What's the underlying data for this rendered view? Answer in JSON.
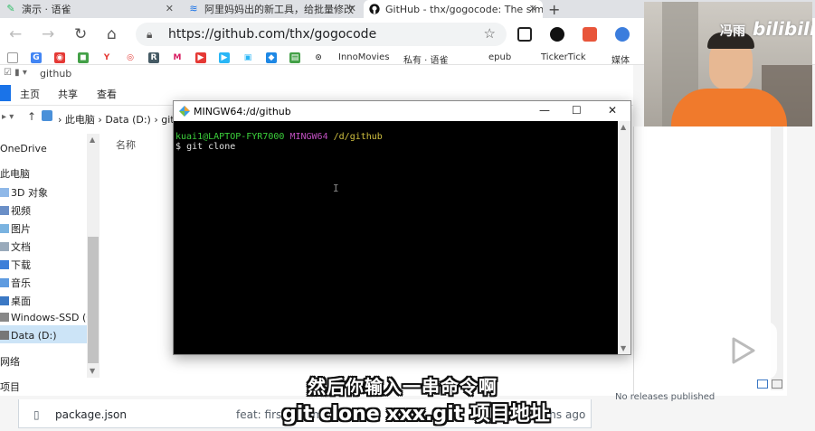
{
  "browser": {
    "tabs": [
      {
        "title": "演示 · 语雀",
        "active": false
      },
      {
        "title": "阿里妈妈出的新工具，给批量修改",
        "active": false
      },
      {
        "title": "GitHub - thx/gogocode: The sim",
        "active": true
      }
    ],
    "url": "https://github.com/thx/gogocode",
    "bookmarks": [
      "InnoMovies",
      "私有 · 语雀",
      "epub",
      "TickerTick",
      "媒体"
    ],
    "colors": {
      "accent": "#1a73e8"
    }
  },
  "explorer": {
    "title": "github",
    "ribbon": [
      "主页",
      "共享",
      "查看"
    ],
    "breadcrumb": [
      "此电脑",
      "Data (D:)",
      "git"
    ],
    "sidebar": [
      {
        "label": "OneDrive",
        "icon": "cloud-icon"
      },
      {
        "label": "此电脑",
        "icon": "computer-icon"
      },
      {
        "label": "3D 对象",
        "icon": "cube-icon"
      },
      {
        "label": "视频",
        "icon": "video-icon"
      },
      {
        "label": "图片",
        "icon": "image-icon"
      },
      {
        "label": "文档",
        "icon": "document-icon"
      },
      {
        "label": "下载",
        "icon": "download-icon"
      },
      {
        "label": "音乐",
        "icon": "music-icon"
      },
      {
        "label": "桌面",
        "icon": "desktop-icon"
      },
      {
        "label": "Windows-SSD (C:)",
        "icon": "drive-icon"
      },
      {
        "label": "Data (D:)",
        "icon": "drive-icon"
      },
      {
        "label": "网络",
        "icon": "network-icon"
      },
      {
        "label": "项目",
        "icon": "none"
      }
    ],
    "column_name": "名称"
  },
  "terminal": {
    "title": "MINGW64:/d/github",
    "prompt_user": "kuai1@LAPTOP-FYR7000",
    "prompt_env": "MINGW64",
    "prompt_path": "/d/github",
    "command_prefix": "$",
    "command": "git clone"
  },
  "github": {
    "file_name": "package.json",
    "commit_message": "feat: first comm",
    "age": "nths ago",
    "no_releases": "No releases published"
  },
  "overlay": {
    "streamer_name": "冯雨",
    "logo_text": "bilibili",
    "subtitle_line1": "然后你输入一串命令啊",
    "subtitle_line2": "git clone xxx.git 项目地址"
  }
}
